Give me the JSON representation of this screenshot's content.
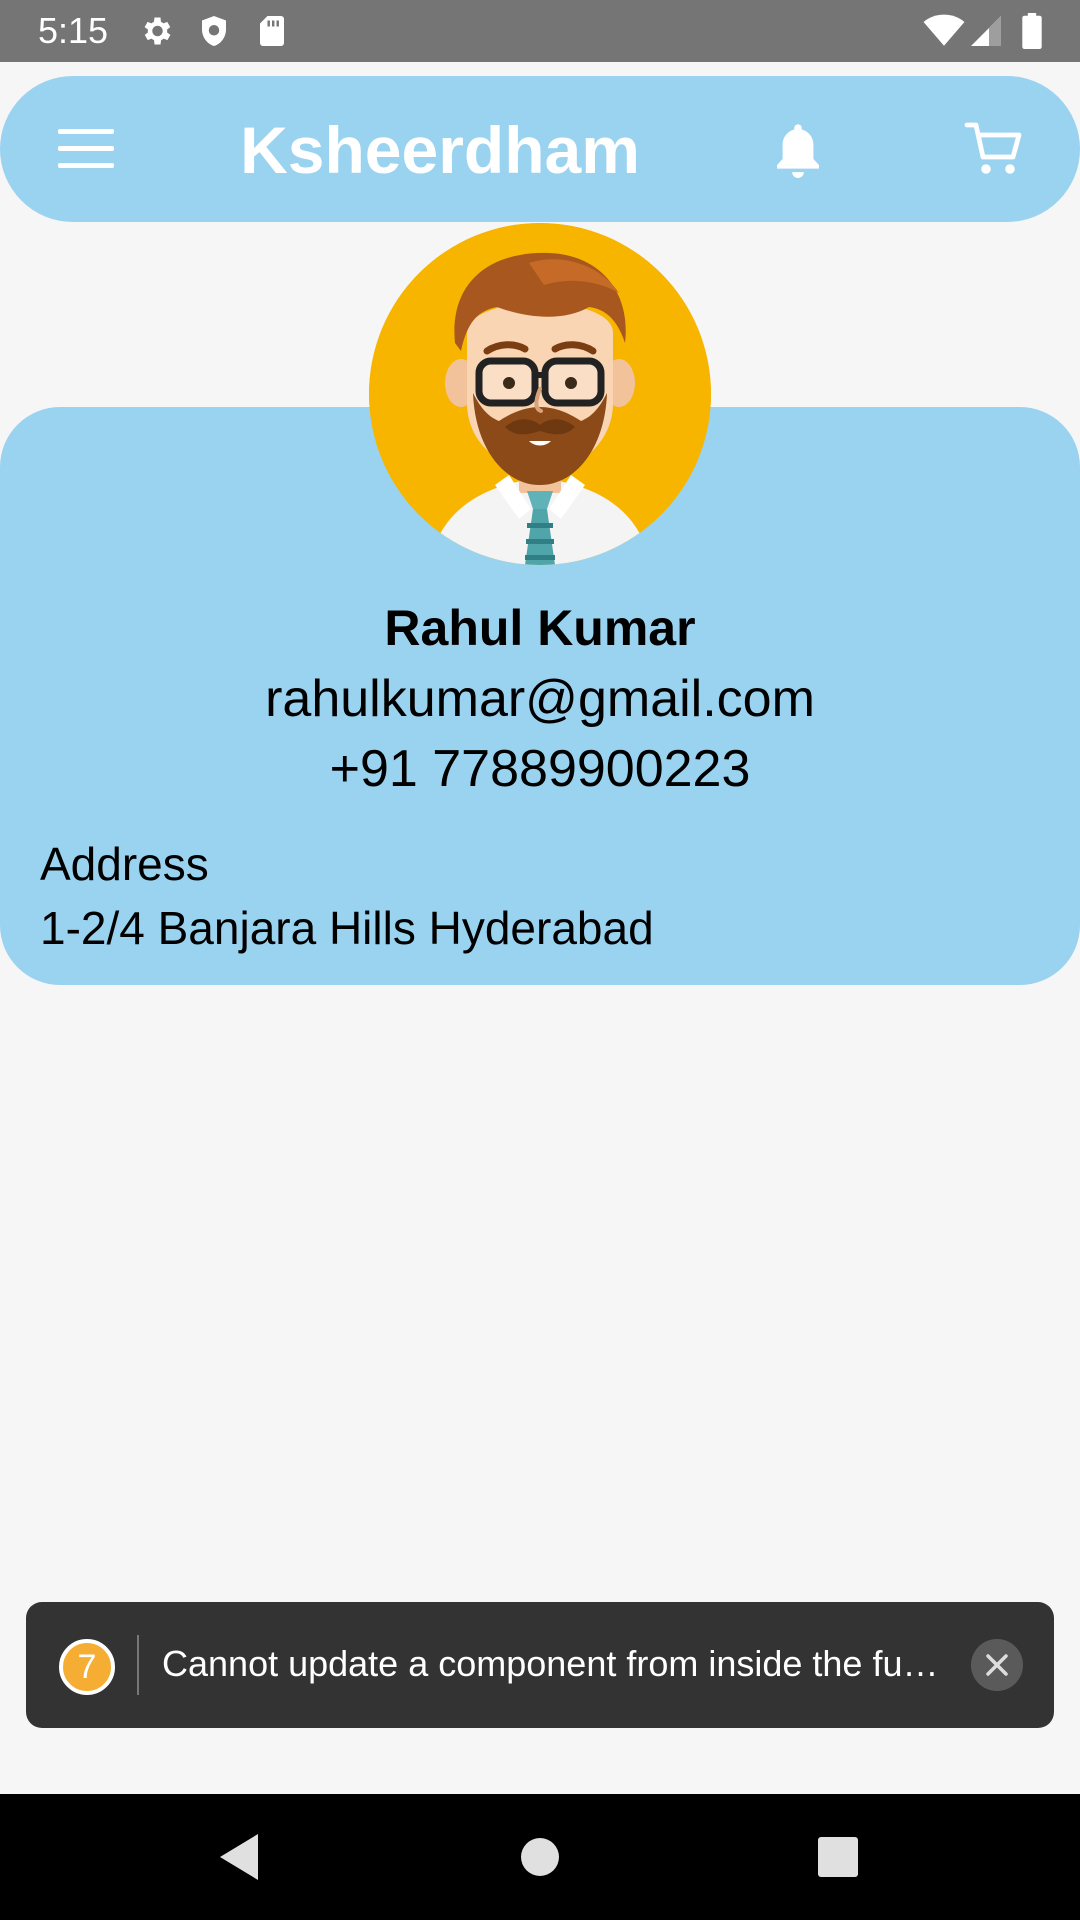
{
  "status_bar": {
    "time": "5:15",
    "left_icons": [
      "settings-gear-icon",
      "shield-icon",
      "sd-card-icon"
    ],
    "right_icons": [
      "wifi-icon",
      "cell-signal-icon",
      "battery-icon"
    ]
  },
  "header": {
    "title": "Ksheerdham",
    "menu_icon": "hamburger-menu-icon",
    "notification_icon": "bell-icon",
    "cart_icon": "shopping-cart-icon",
    "background_color": "#9ad3f0"
  },
  "profile": {
    "avatar_icon": "man-avatar-with-glasses-icon",
    "avatar_background": "#f7b500",
    "name": "Rahul Kumar",
    "email": "rahulkumar@gmail.com",
    "phone": "+91 77889900223",
    "address_label": "Address",
    "address": "1-2/4 Banjara Hills Hyderabad"
  },
  "warning_toast": {
    "count": "7",
    "message": "Cannot update a component from inside the fu…",
    "close_icon": "close-icon",
    "badge_color": "#f5ad33"
  },
  "nav_bar": {
    "buttons": [
      "back-triangle-icon",
      "home-circle-icon",
      "recents-square-icon"
    ]
  }
}
